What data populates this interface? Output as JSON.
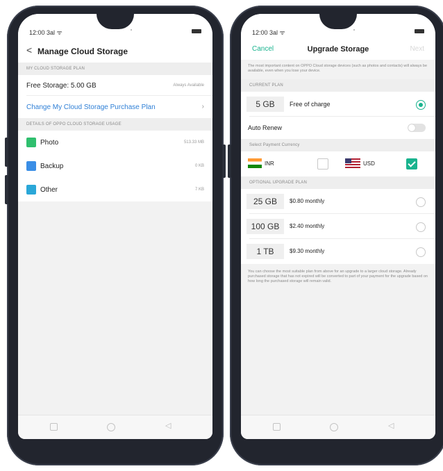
{
  "left_screen": {
    "status": {
      "time": "12:00 3al ᯤ"
    },
    "header": {
      "back": "<",
      "title": "Manage Cloud Storage"
    },
    "plan_section": "MY CLOUD STORAGE PLAN",
    "free_storage": {
      "label": "Free Storage: 5.00 GB",
      "right": "Always Available"
    },
    "change_plan": "Change My Cloud Storage Purchase Plan",
    "details_section": "DETAILS OF OPPO CLOUD STORAGE USAGE",
    "usage": [
      {
        "label": "Photo",
        "size": "513.33 MB",
        "color": "#2fbf6e"
      },
      {
        "label": "Backup",
        "size": "0 KB",
        "color": "#3a8ee6"
      },
      {
        "label": "Other",
        "size": "7 KB",
        "color": "#2aa7d8"
      }
    ]
  },
  "right_screen": {
    "status": {
      "time": "12:00 3al ᯤ"
    },
    "header": {
      "cancel": "Cancel",
      "title": "Upgrade Storage",
      "next": "Next"
    },
    "intro": "The most important content on OPPO Cloud storage devices (such as photos and contacts) will always be available, even when you lose your device.",
    "current_section": "CURRENT PLAN",
    "current_plan": {
      "size": "5 GB",
      "price": "Free of charge"
    },
    "auto_renew": "Auto Renew",
    "currency_section": "Select Payment Currency",
    "currencies": [
      {
        "code": "INR",
        "selected": false
      },
      {
        "code": "USD",
        "selected": true
      }
    ],
    "optional_section": "OPTIONAL UPGRADE PLAN",
    "plans": [
      {
        "size": "25 GB",
        "price": "$0.80 monthly"
      },
      {
        "size": "100 GB",
        "price": "$2.40 monthly"
      },
      {
        "size": "1 TB",
        "price": "$9.30 monthly"
      }
    ],
    "footnote": "You can choose the most suitable plan from above for an upgrade to a larger cloud storage. Already purchased storage that has not expired will be converted to part of your payment for the upgrade based on how long the purchased storage will remain valid."
  },
  "colors": {
    "accent": "#19b38e",
    "link": "#2e7fd6",
    "phone_frame": "#22252e"
  }
}
